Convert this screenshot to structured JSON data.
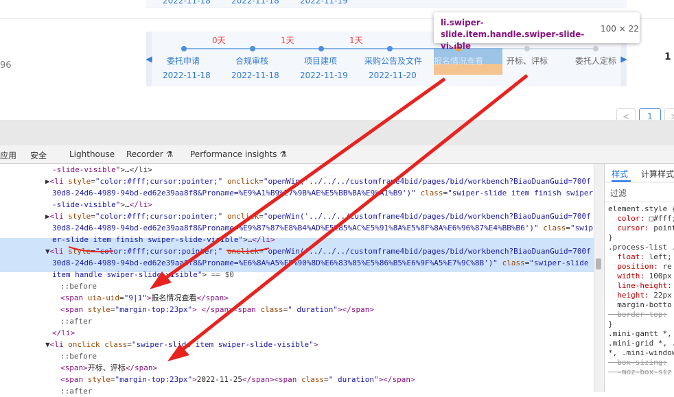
{
  "page": {
    "top_dates": [
      "2022-11-18",
      "2022-11-18",
      "2022-11-19"
    ],
    "left_number": "96",
    "right_number": "1",
    "pager_current": "1",
    "pager_prev": "<",
    "pager_next": ">"
  },
  "process": {
    "durations": [
      "0天",
      "1天",
      "1天"
    ],
    "steps": [
      {
        "label": "委托申请",
        "date": "2022-11-18"
      },
      {
        "label": "合规审核",
        "date": "2022-11-18"
      },
      {
        "label": "项目建项",
        "date": "2022-11-19"
      },
      {
        "label": "采购公告及文件",
        "date": "2022-11-20"
      },
      {
        "label": "报名情况查看",
        "date": ""
      },
      {
        "label": "开标、评标",
        "date": ""
      },
      {
        "label": "委托人定标",
        "date": ""
      }
    ],
    "prev_arrow": "◀",
    "next_arrow": "▶"
  },
  "tooltip": {
    "selector": "li.swiper-slide.item.handle.swiper-slide-visible",
    "size": "100 × 22"
  },
  "devtools": {
    "tabs": [
      "应用",
      "安全",
      "Lighthouse",
      "Recorder",
      "Performance insights"
    ],
    "lines": [
      {
        "indent": 76,
        "html": "<span class='tag'>-slide-visible</span>\"&gt;…&lt;/li&gt;"
      },
      {
        "indent": 66,
        "html": "▶<span class='tag'>&lt;li </span><span class='attr'>style</span>=<span class='val'>\"color:#fff;cursor:pointer;\"</span> <span class='attr'>onclick</span>=<span class='val'>\"openWin('../../../customframe4bid/pages/bid/workbench?BiaoDuanGuid=700f</span>"
      },
      {
        "indent": 76,
        "html": "<span class='val'>30d8-24d6-4989-94bd-ed62e39aa8f8&amp;Proname=%E9%A1%B9%E7%9B%AE%E5%BB%BA%E9%A1%B9')\"</span> <span class='attr'>class</span>=<span class='val'>\"swiper-slide item finish swiper</span>"
      },
      {
        "indent": 76,
        "html": "<span class='val'>-slide-visible\"</span>&gt;…<span class='tag'>&lt;/li&gt;</span>"
      },
      {
        "indent": 66,
        "html": "▶<span class='tag'>&lt;li </span><span class='attr'>style</span>=<span class='val'>\"color:#fff;cursor:pointer;\"</span> <span class='attr'>onclick</span>=<span class='val'>\"openWin('../../../customframe4bid/pages/bid/workbench?BiaoDuanGuid=700f</span>"
      },
      {
        "indent": 76,
        "html": "<span class='val'>30d8-24d6-4989-94bd-ed62e39aa8f8&amp;Proname=%E9%87%87%E8%B4%AD%E5%85%AC%E5%91%8A%E5%8F%8A%E6%96%87%E4%BB%B6')\"</span> <span class='attr'>class</span>=<span class='val'>\"swip</span>"
      },
      {
        "indent": 76,
        "html": "<span class='val'>er-slide item finish swiper-slide-visible\"</span>&gt;…<span class='tag'>&lt;/li&gt;</span>"
      },
      {
        "indent": 66,
        "html": "▼<span class='tag'>&lt;li </span><span class='attr'>style</span>=<span class='val'>\"color:#fff;cursor:pointer;\"</span> <span class='attr'>onclick</span>=<span class='val'>\"openWin('../../../customframe4bid/pages/bid/workbench?BiaoDuanGuid=700f</span>"
      },
      {
        "indent": 76,
        "html": "<span class='val'>30d8-24d6-4989-94bd-ed62e39aa8f8&amp;Proname=%E6%8A%A5%E5%90%8D%E6%83%85%E5%86%B5%E6%9F%A5%E7%9C%8B')\"</span> <span class='attr'>class</span>=<span class='val'>\"swiper-slide</span>"
      },
      {
        "indent": 76,
        "html": "<span class='val'>item handle swiper-slide-visible\"</span>&gt; <span class='pseudo'>== $0</span>"
      },
      {
        "indent": 88,
        "html": "<span class='pseudo'>::before</span>"
      },
      {
        "indent": 88,
        "html": "<span class='tag'>&lt;span </span><span class='attr'>uia-uid</span>=<span class='val'>\"9|1\"</span><span class='tag'>&gt;</span><span class='txt'>报名情况查看</span><span class='tag'>&lt;/span&gt;</span>"
      },
      {
        "indent": 88,
        "html": "<span class='tag'>&lt;span </span><span class='attr'>style</span>=<span class='val'>\"margin-top:23px\"</span><span class='tag'>&gt; &lt;/span&gt;&lt;span </span><span class='attr'>class</span>=<span class='val'>\" duration\"</span><span class='tag'>&gt;&lt;/span&gt;</span>"
      },
      {
        "indent": 88,
        "html": "<span class='pseudo'>::after</span>"
      },
      {
        "indent": 76,
        "html": "<span class='tag'>&lt;/li&gt;</span>"
      },
      {
        "indent": 66,
        "html": "▼<span class='tag'>&lt;li </span><span class='attr'>onclick</span> <span class='attr'>class</span>=<span class='val'>\"swiper-slide item swiper-slide-visible\"</span><span class='tag'>&gt;</span>"
      },
      {
        "indent": 88,
        "html": "<span class='pseudo'>::before</span>"
      },
      {
        "indent": 88,
        "html": "<span class='tag'>&lt;span&gt;</span><span class='txt'>开标、评标</span><span class='tag'>&lt;/span&gt;</span>"
      },
      {
        "indent": 88,
        "html": "<span class='tag'>&lt;span </span><span class='attr'>style</span>=<span class='val'>\"margin-top:23px\"</span><span class='tag'>&gt;</span><span class='txt'>2022-11-25</span><span class='tag'>&lt;/span&gt;&lt;span </span><span class='attr'>class</span>=<span class='val'>\" duration\"</span><span class='tag'>&gt;&lt;/span&gt;</span>"
      },
      {
        "indent": 88,
        "html": "<span class='pseudo'>::after</span>"
      }
    ],
    "styles_tabs": [
      "样式",
      "计算样式"
    ],
    "filter_placeholder": "过滤",
    "style_lines": [
      "element.style {",
      "  color: □#fff;",
      "  cursor: point",
      "}",
      ".process-list .",
      "  float: left;",
      "  position: re",
      "  width: 100px",
      "  line-height:",
      "  height: 22px",
      "  margin-botto",
      "  border-top:",
      "}",
      ".mini-gantt *,",
      ".mini-grid *, .",
      "*, .mini-window",
      "  box-sizing:",
      "  -moz-box-siz"
    ]
  },
  "colors": {
    "accent": "#2f7bd1",
    "duration": "#e84d4d",
    "annotation": "#e8231f",
    "tag": "#881280"
  }
}
